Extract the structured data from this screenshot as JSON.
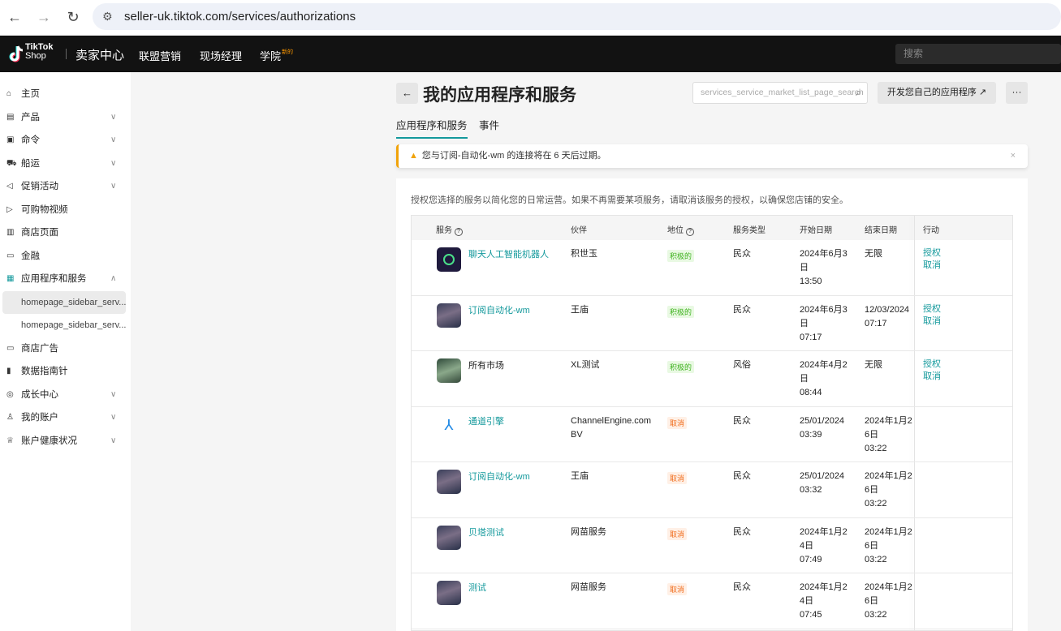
{
  "browser": {
    "url": "seller-uk.tiktok.com/services/authorizations"
  },
  "header": {
    "logo_line1": "TikTok",
    "logo_line2": "Shop",
    "seller_center": "卖家中心",
    "nav": [
      "联盟营销",
      "现场经理",
      "学院"
    ],
    "new_badge": "新的",
    "search_placeholder": "搜索"
  },
  "sidebar": {
    "items": [
      {
        "label": "主页",
        "icon": "home-icon",
        "chev": ""
      },
      {
        "label": "产品",
        "icon": "product-icon",
        "chev": "∨"
      },
      {
        "label": "命令",
        "icon": "order-icon",
        "chev": "∨"
      },
      {
        "label": "船运",
        "icon": "truck-icon",
        "chev": "∨"
      },
      {
        "label": "促销活动",
        "icon": "megaphone-icon",
        "chev": "∨"
      },
      {
        "label": "可购物视频",
        "icon": "video-icon",
        "chev": ""
      },
      {
        "label": "商店页面",
        "icon": "store-icon",
        "chev": ""
      },
      {
        "label": "金融",
        "icon": "wallet-icon",
        "chev": ""
      },
      {
        "label": "应用程序和服务",
        "icon": "apps-icon",
        "chev": "∧"
      },
      {
        "label": "homepage_sidebar_serv...",
        "icon": "",
        "chev": ""
      },
      {
        "label": "homepage_sidebar_serv...",
        "icon": "",
        "chev": ""
      },
      {
        "label": "商店广告",
        "icon": "ad-icon",
        "chev": ""
      },
      {
        "label": "数据指南针",
        "icon": "chart-icon",
        "chev": ""
      },
      {
        "label": "成长中心",
        "icon": "growth-icon",
        "chev": "∨"
      },
      {
        "label": "我的账户",
        "icon": "user-icon",
        "chev": "∨"
      },
      {
        "label": "账户健康状况",
        "icon": "trophy-icon",
        "chev": "∨"
      }
    ]
  },
  "page": {
    "title": "我的应用程序和服务",
    "search_placeholder": "services_service_market_list_page_search",
    "dev_button": "开发您自己的应用程序",
    "more": "···",
    "tabs": [
      "应用程序和服务",
      "事件"
    ],
    "alert": "您与订阅-自动化-wm 的连接将在 6 天后过期。",
    "description": "授权您选择的服务以简化您的日常运营。如果不再需要某项服务，请取消该服务的授权，以确保您店铺的安全。"
  },
  "table": {
    "headers": [
      "服务",
      "伙伴",
      "地位",
      "服务类型",
      "开始日期",
      "结束日期",
      "行动"
    ],
    "rows": [
      {
        "service": "聊天人工智能机器人",
        "link": true,
        "icon": "chatbot",
        "partner": "积世玉",
        "status": "积极的",
        "active": true,
        "type": "民众",
        "start": "2024年6月3\n日\n13:50",
        "end": "无限",
        "actions": [
          "授权",
          "取消"
        ]
      },
      {
        "service": "订阅自动化-wm",
        "link": true,
        "icon": "portrait",
        "partner": "王庙",
        "status": "积极的",
        "active": true,
        "type": "民众",
        "start": "2024年6月3\n日\n07:17",
        "end": "12/03/2024\n07:17",
        "actions": [
          "授权",
          "取消"
        ]
      },
      {
        "service": "所有市场",
        "link": false,
        "icon": "landscape",
        "partner": "XL测试",
        "status": "积极的",
        "active": true,
        "type": "风俗",
        "start": "2024年4月2\n日\n08:44",
        "end": "无限",
        "actions": [
          "授权",
          "取消"
        ]
      },
      {
        "service": "通道引擎",
        "link": true,
        "icon": "channelengine",
        "partner": "ChannelEngine.com\nBV",
        "status": "取消",
        "active": false,
        "type": "民众",
        "start": "25/01/2024\n03:39",
        "end": "2024年1月2\n6日\n03:22",
        "actions": []
      },
      {
        "service": "订阅自动化-wm",
        "link": true,
        "icon": "portrait",
        "partner": "王庙",
        "status": "取消",
        "active": false,
        "type": "民众",
        "start": "25/01/2024\n03:32",
        "end": "2024年1月2\n6日\n03:22",
        "actions": []
      },
      {
        "service": "贝塔测试",
        "link": true,
        "icon": "portrait",
        "partner": "网苗服务",
        "status": "取消",
        "active": false,
        "type": "民众",
        "start": "2024年1月2\n4日\n07:49",
        "end": "2024年1月2\n6日\n03:22",
        "actions": []
      },
      {
        "service": "测试",
        "link": true,
        "icon": "portrait",
        "partner": "网苗服务",
        "status": "取消",
        "active": false,
        "type": "民众",
        "start": "2024年1月2\n4日\n07:45",
        "end": "2024年1月2\n6日\n03:22",
        "actions": []
      }
    ]
  }
}
